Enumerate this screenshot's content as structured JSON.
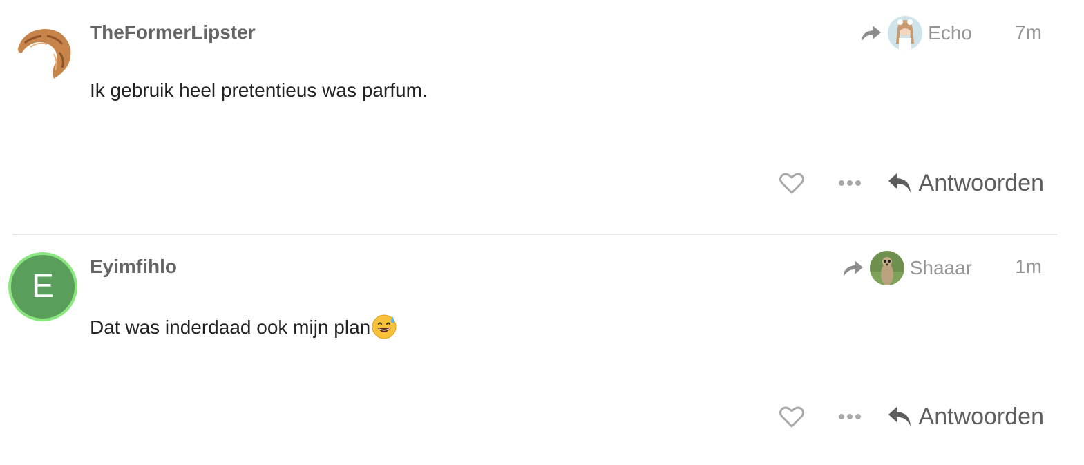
{
  "posts": [
    {
      "username": "TheFormerLipster",
      "avatar_icon": "croissant-icon",
      "reply_to": {
        "username": "Echo",
        "icon": "share-icon"
      },
      "date": "7m",
      "body": "Ik gebruik heel pretentieus was parfum.",
      "actions": {
        "like_icon": "heart-icon",
        "more_icon": "ellipsis-icon",
        "reply_label": "Antwoorden"
      }
    },
    {
      "username": "Eyimfihlo",
      "avatar_letter": "E",
      "avatar_color": "#5a9e5c",
      "avatar_ring_color": "#8ae77e",
      "reply_to": {
        "username": "Shaaar",
        "icon": "share-icon"
      },
      "date": "1m",
      "body": "Dat was inderdaad ook mijn plan",
      "body_emoji": "grinning-face-with-sweat-emoji",
      "actions": {
        "like_icon": "heart-icon",
        "more_icon": "ellipsis-icon",
        "reply_label": "Antwoorden"
      }
    }
  ]
}
